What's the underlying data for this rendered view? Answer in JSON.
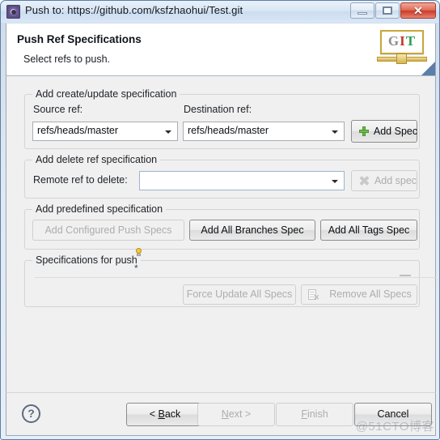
{
  "window": {
    "title": "Push to: https://github.com/ksfzhaohui/Test.git",
    "icon": "push-wizard-icon",
    "controls": {
      "minimize": "minimize-icon",
      "maximize": "maximize-icon",
      "close": "✕"
    }
  },
  "header": {
    "title": "Push Ref Specifications",
    "subtitle": "Select refs to push.",
    "logo": {
      "g": "G",
      "i": "I",
      "t": "T"
    }
  },
  "groups": {
    "create_update": {
      "title": "Add create/update specification",
      "source_label": "Source ref:",
      "source_value": "refs/heads/master",
      "destination_label": "Destination ref:",
      "destination_value": "refs/heads/master",
      "add_spec_button": "Add Spec"
    },
    "delete_ref": {
      "title": "Add delete ref specification",
      "remote_label": "Remote ref to delete:",
      "remote_value": "",
      "assist_star": "*",
      "add_spec_button": "Add spec"
    },
    "predefined": {
      "title": "Add predefined specification",
      "add_configured_push_specs": "Add Configured Push Specs",
      "add_all_branches_spec": "Add All Branches Spec",
      "add_all_tags_spec": "Add All Tags Spec"
    },
    "specs_for_push": {
      "title": "Specifications for push",
      "force_update_all_specs": "Force Update All Specs",
      "remove_all_specs": "Remove All Specs"
    }
  },
  "footer": {
    "help": "?",
    "back": "< Back",
    "back_mnemonic": "B",
    "next": "Next >",
    "next_mnemonic": "N",
    "finish": "Finish",
    "finish_mnemonic": "F",
    "cancel": "Cancel"
  },
  "watermark": "@51CTO博客",
  "colors": {
    "accent": "#5a7fa8",
    "close_button": "#c93b26",
    "plus_icon": "#6cbe4a",
    "client_bg": "#f0f0f0"
  }
}
